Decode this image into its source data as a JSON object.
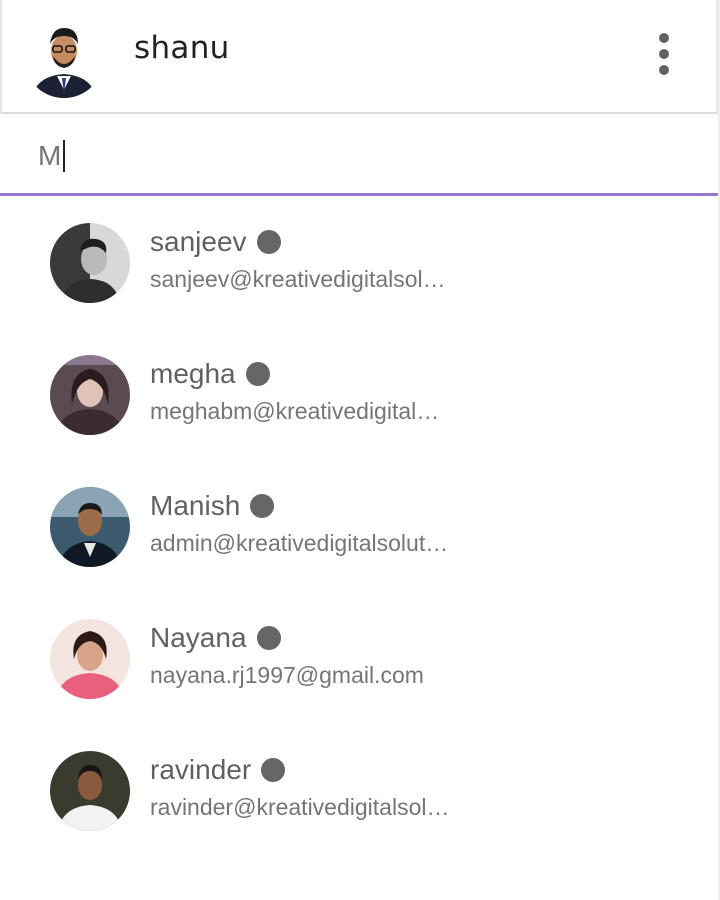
{
  "header": {
    "user_name": "shanu",
    "avatar_icon": "user-avatar-photo",
    "menu_icon": "more-vert-icon"
  },
  "search": {
    "value": "M",
    "accent_color": "#9575cd"
  },
  "contacts": [
    {
      "name": "sanjeev",
      "email": "sanjeev@kreativedigitalsol…",
      "status_color": "#666666"
    },
    {
      "name": "megha",
      "email": "meghabm@kreativedigital…",
      "status_color": "#666666"
    },
    {
      "name": "Manish",
      "email": "admin@kreativedigitalsolut…",
      "status_color": "#666666"
    },
    {
      "name": "Nayana",
      "email": "nayana.rj1997@gmail.com",
      "status_color": "#666666"
    },
    {
      "name": "ravinder",
      "email": "ravinder@kreativedigitalsol…",
      "status_color": "#666666"
    }
  ]
}
